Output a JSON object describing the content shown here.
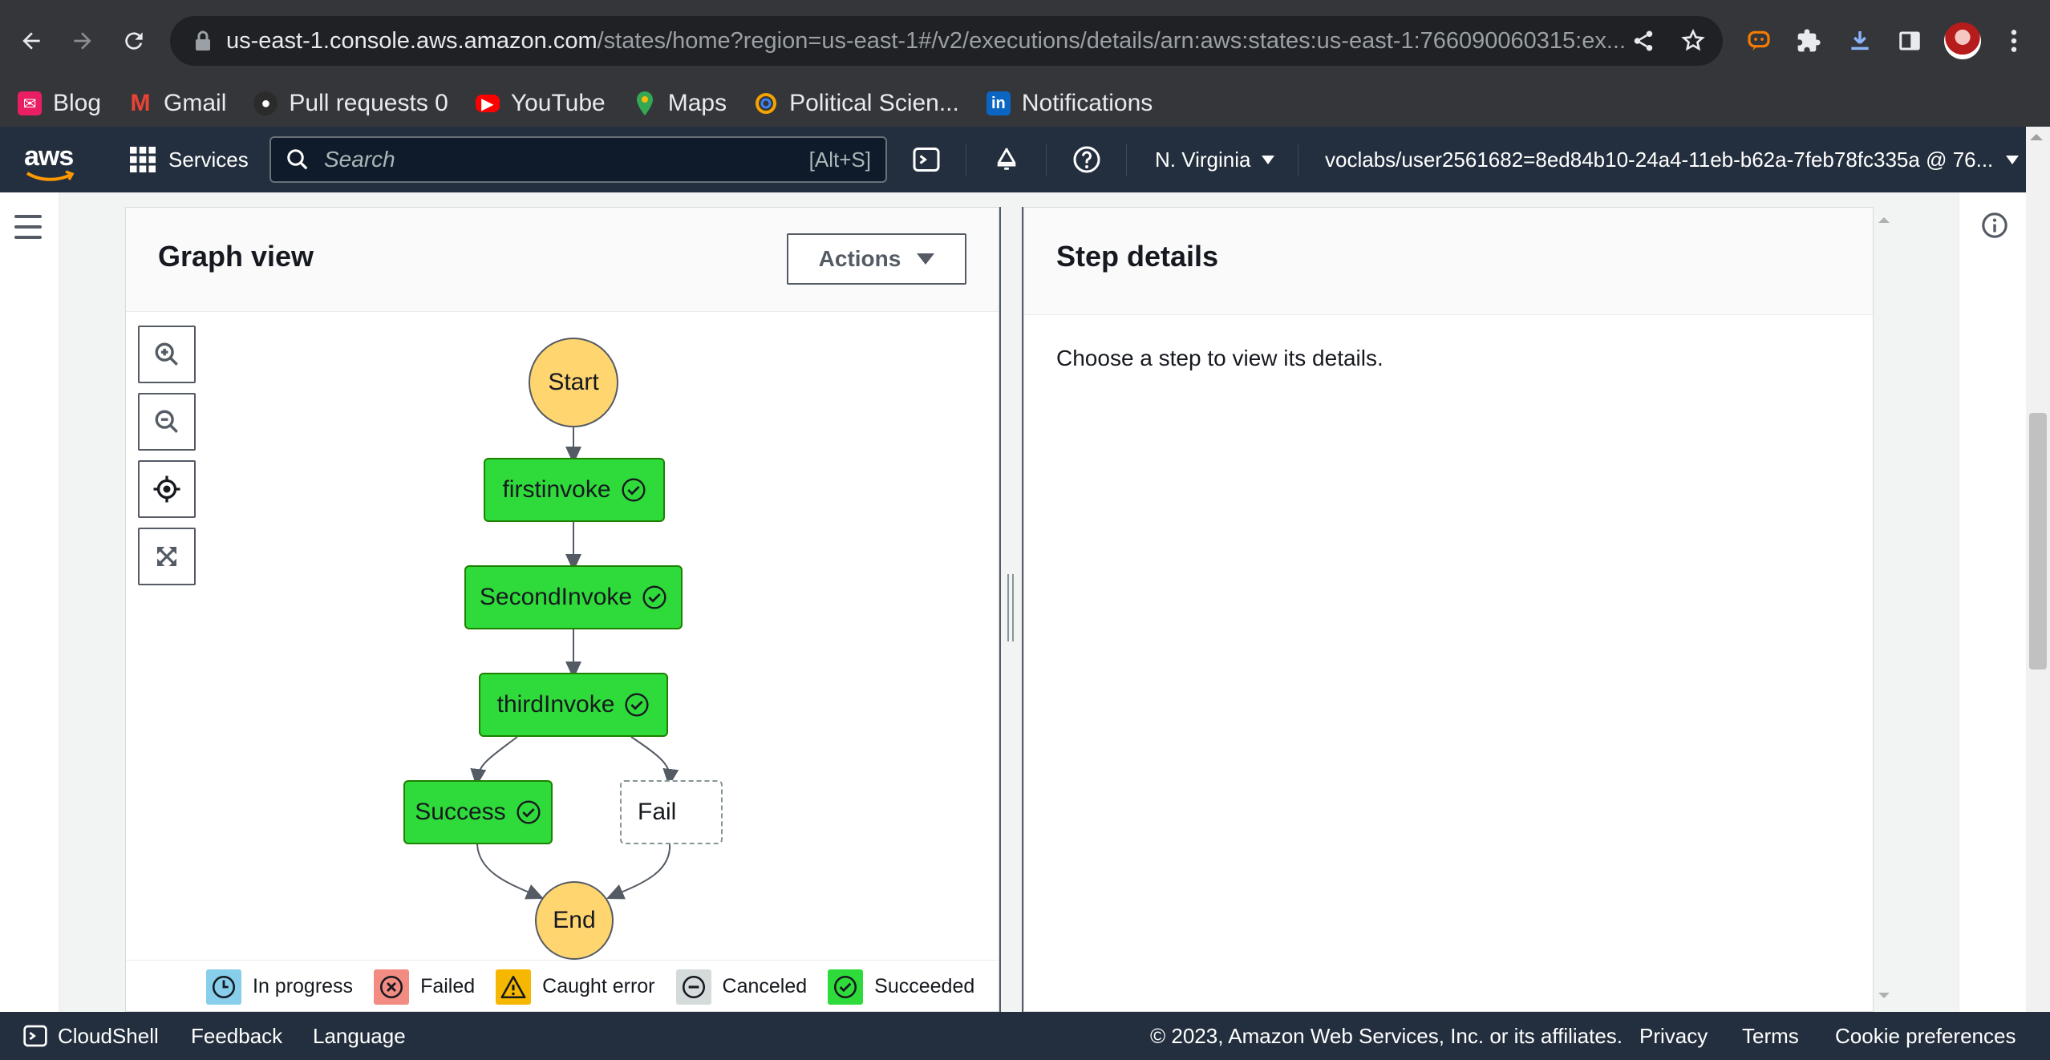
{
  "browser": {
    "url_host": "us-east-1.console.aws.amazon.com",
    "url_path": "/states/home?region=us-east-1#/v2/executions/details/arn:aws:states:us-east-1:766090060315:ex...",
    "bookmarks": [
      {
        "label": "Blog",
        "icon": "blog-icon",
        "color": "#e91e63"
      },
      {
        "label": "Gmail",
        "icon": "gmail-icon",
        "color": "#ea4335"
      },
      {
        "label": "Pull requests 0",
        "icon": "github-icon",
        "color": "#2b2b2b"
      },
      {
        "label": "YouTube",
        "icon": "youtube-icon",
        "color": "#ff0000"
      },
      {
        "label": "Maps",
        "icon": "maps-icon",
        "color": "#34a853"
      },
      {
        "label": "Political Scien...",
        "icon": "political-science-icon",
        "color": "#f4a300"
      },
      {
        "label": "Notifications",
        "icon": "linkedin-icon",
        "color": "#0a66c2"
      }
    ]
  },
  "aws_header": {
    "logo": "aws",
    "services_label": "Services",
    "search_placeholder": "Search",
    "search_shortcut": "[Alt+S]",
    "region": "N. Virginia",
    "account": "voclabs/user2561682=8ed84b10-24a4-11eb-b62a-7feb78fc335a @ 76..."
  },
  "graph_view": {
    "title": "Graph view",
    "actions_label": "Actions",
    "nodes": {
      "start": "Start",
      "first": "firstinvoke",
      "second": "SecondInvoke",
      "third": "thirdInvoke",
      "success": "Success",
      "fail": "Fail",
      "end": "End"
    },
    "legend": [
      {
        "label": "In progress",
        "color": "#87ceeb"
      },
      {
        "label": "Failed",
        "color": "#f28b82"
      },
      {
        "label": "Caught error",
        "color": "#f5b700"
      },
      {
        "label": "Canceled",
        "color": "#d5dbdb"
      },
      {
        "label": "Succeeded",
        "color": "#2fdb3a"
      }
    ]
  },
  "step_details": {
    "title": "Step details",
    "empty_message": "Choose a step to view its details."
  },
  "footer": {
    "cloudshell": "CloudShell",
    "feedback": "Feedback",
    "language": "Language",
    "copyright": "© 2023, Amazon Web Services, Inc. or its affiliates.",
    "privacy": "Privacy",
    "terms": "Terms",
    "cookies": "Cookie preferences"
  },
  "colors": {
    "aws_nav": "#232f3e",
    "succeeded_green": "#2fdb3a",
    "start_end_yellow": "#ffd56f"
  }
}
